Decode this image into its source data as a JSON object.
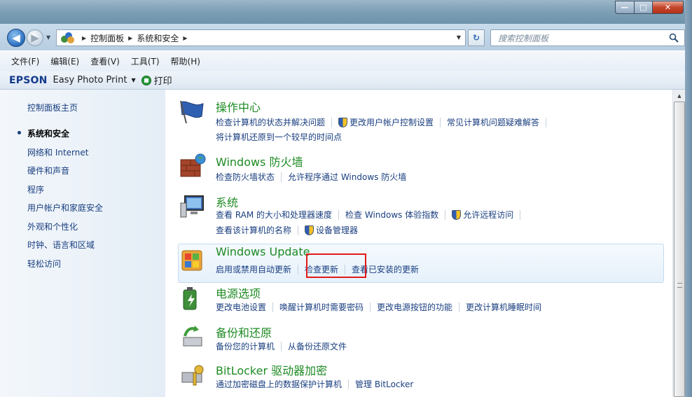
{
  "window": {
    "minimize_label": "—",
    "maximize_label": "□",
    "close_label": "✕"
  },
  "address": {
    "crumbs": [
      "控制面板",
      "系统和安全"
    ],
    "search_placeholder": "搜索控制面板"
  },
  "menu": [
    "文件(F)",
    "编辑(E)",
    "查看(V)",
    "工具(T)",
    "帮助(H)"
  ],
  "toolbar": {
    "brand": "EPSON",
    "app": "Easy Photo Print",
    "print": "打印"
  },
  "left": {
    "home": "控制面板主页",
    "items": [
      "系统和安全",
      "网络和 Internet",
      "硬件和声音",
      "程序",
      "用户帐户和家庭安全",
      "外观和个性化",
      "时钟、语言和区域",
      "轻松访问"
    ]
  },
  "categories": {
    "action_center": {
      "title": "操作中心",
      "links1": [
        "检查计算机的状态并解决问题",
        "更改用户帐户控制设置",
        "常见计算机问题疑难解答"
      ],
      "links2": [
        "将计算机还原到一个较早的时间点"
      ]
    },
    "firewall": {
      "title": "Windows 防火墙",
      "links1": [
        "检查防火墙状态",
        "允许程序通过 Windows 防火墙"
      ]
    },
    "system": {
      "title": "系统",
      "links1": [
        "查看 RAM 的大小和处理器速度",
        "检查 Windows 体验指数",
        "允许远程访问"
      ],
      "links2": [
        "查看该计算机的名称",
        "设备管理器"
      ]
    },
    "update": {
      "title": "Windows Update",
      "links1": [
        "启用或禁用自动更新",
        "检查更新",
        "查看已安装的更新"
      ]
    },
    "power": {
      "title": "电源选项",
      "links1": [
        "更改电池设置",
        "唤醒计算机时需要密码",
        "更改电源按钮的功能",
        "更改计算机睡眠时间"
      ]
    },
    "backup": {
      "title": "备份和还原",
      "links1": [
        "备份您的计算机",
        "从备份还原文件"
      ]
    },
    "bitlocker": {
      "title": "BitLocker 驱动器加密",
      "links1": [
        "通过加密磁盘上的数据保护计算机",
        "管理 BitLocker"
      ]
    }
  }
}
